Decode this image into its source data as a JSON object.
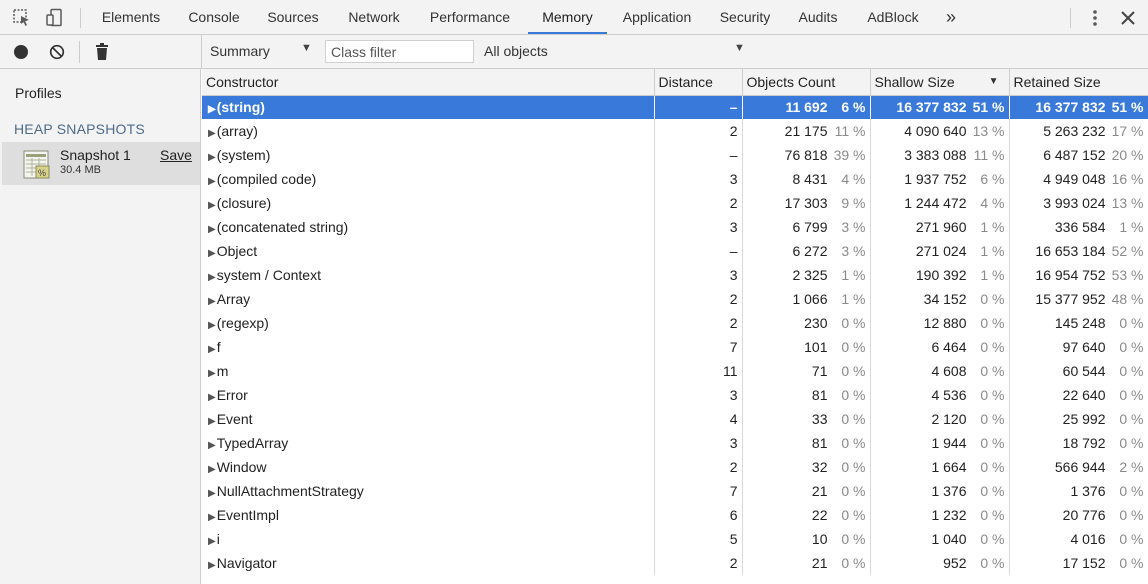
{
  "tabs": [
    {
      "label": "Elements",
      "active": false
    },
    {
      "label": "Console",
      "active": false
    },
    {
      "label": "Sources",
      "active": false
    },
    {
      "label": "Network",
      "active": false
    },
    {
      "label": "Performance",
      "active": false
    },
    {
      "label": "Memory",
      "active": true
    },
    {
      "label": "Application",
      "active": false
    },
    {
      "label": "Security",
      "active": false
    },
    {
      "label": "Audits",
      "active": false
    },
    {
      "label": "AdBlock",
      "active": false
    }
  ],
  "toolbar": {
    "overflow": "»",
    "view_select": "Summary",
    "class_filter_placeholder": "Class filter",
    "objects_select": "All objects"
  },
  "sidebar": {
    "title": "Profiles",
    "heading": "HEAP SNAPSHOTS",
    "snapshot": {
      "name": "Snapshot 1",
      "size": "30.4 MB",
      "save": "Save"
    }
  },
  "table": {
    "columns": [
      "Constructor",
      "Distance",
      "Objects Count",
      "Shallow Size",
      "Retained Size"
    ],
    "sorted_column": "Shallow Size",
    "rows": [
      {
        "name": "(string)",
        "distance": "–",
        "count": "11 692",
        "count_pct": "6 %",
        "shallow": "16 377 832",
        "shallow_pct": "51 %",
        "retained": "16 377 832",
        "retained_pct": "51 %",
        "selected": true
      },
      {
        "name": "(array)",
        "distance": "2",
        "count": "21 175",
        "count_pct": "11 %",
        "shallow": "4 090 640",
        "shallow_pct": "13 %",
        "retained": "5 263 232",
        "retained_pct": "17 %"
      },
      {
        "name": "(system)",
        "distance": "–",
        "count": "76 818",
        "count_pct": "39 %",
        "shallow": "3 383 088",
        "shallow_pct": "11 %",
        "retained": "6 487 152",
        "retained_pct": "20 %"
      },
      {
        "name": "(compiled code)",
        "distance": "3",
        "count": "8 431",
        "count_pct": "4 %",
        "shallow": "1 937 752",
        "shallow_pct": "6 %",
        "retained": "4 949 048",
        "retained_pct": "16 %"
      },
      {
        "name": "(closure)",
        "distance": "2",
        "count": "17 303",
        "count_pct": "9 %",
        "shallow": "1 244 472",
        "shallow_pct": "4 %",
        "retained": "3 993 024",
        "retained_pct": "13 %"
      },
      {
        "name": "(concatenated string)",
        "distance": "3",
        "count": "6 799",
        "count_pct": "3 %",
        "shallow": "271 960",
        "shallow_pct": "1 %",
        "retained": "336 584",
        "retained_pct": "1 %"
      },
      {
        "name": "Object",
        "distance": "–",
        "count": "6 272",
        "count_pct": "3 %",
        "shallow": "271 024",
        "shallow_pct": "1 %",
        "retained": "16 653 184",
        "retained_pct": "52 %"
      },
      {
        "name": "system / Context",
        "distance": "3",
        "count": "2 325",
        "count_pct": "1 %",
        "shallow": "190 392",
        "shallow_pct": "1 %",
        "retained": "16 954 752",
        "retained_pct": "53 %"
      },
      {
        "name": "Array",
        "distance": "2",
        "count": "1 066",
        "count_pct": "1 %",
        "shallow": "34 152",
        "shallow_pct": "0 %",
        "retained": "15 377 952",
        "retained_pct": "48 %"
      },
      {
        "name": "(regexp)",
        "distance": "2",
        "count": "230",
        "count_pct": "0 %",
        "shallow": "12 880",
        "shallow_pct": "0 %",
        "retained": "145 248",
        "retained_pct": "0 %"
      },
      {
        "name": "f",
        "distance": "7",
        "count": "101",
        "count_pct": "0 %",
        "shallow": "6 464",
        "shallow_pct": "0 %",
        "retained": "97 640",
        "retained_pct": "0 %"
      },
      {
        "name": "m",
        "distance": "11",
        "count": "71",
        "count_pct": "0 %",
        "shallow": "4 608",
        "shallow_pct": "0 %",
        "retained": "60 544",
        "retained_pct": "0 %"
      },
      {
        "name": "Error",
        "distance": "3",
        "count": "81",
        "count_pct": "0 %",
        "shallow": "4 536",
        "shallow_pct": "0 %",
        "retained": "22 640",
        "retained_pct": "0 %"
      },
      {
        "name": "Event",
        "distance": "4",
        "count": "33",
        "count_pct": "0 %",
        "shallow": "2 120",
        "shallow_pct": "0 %",
        "retained": "25 992",
        "retained_pct": "0 %"
      },
      {
        "name": "TypedArray",
        "distance": "3",
        "count": "81",
        "count_pct": "0 %",
        "shallow": "1 944",
        "shallow_pct": "0 %",
        "retained": "18 792",
        "retained_pct": "0 %"
      },
      {
        "name": "Window",
        "distance": "2",
        "count": "32",
        "count_pct": "0 %",
        "shallow": "1 664",
        "shallow_pct": "0 %",
        "retained": "566 944",
        "retained_pct": "2 %"
      },
      {
        "name": "NullAttachmentStrategy",
        "distance": "7",
        "count": "21",
        "count_pct": "0 %",
        "shallow": "1 376",
        "shallow_pct": "0 %",
        "retained": "1 376",
        "retained_pct": "0 %"
      },
      {
        "name": "EventImpl",
        "distance": "6",
        "count": "22",
        "count_pct": "0 %",
        "shallow": "1 232",
        "shallow_pct": "0 %",
        "retained": "20 776",
        "retained_pct": "0 %"
      },
      {
        "name": "i",
        "distance": "5",
        "count": "10",
        "count_pct": "0 %",
        "shallow": "1 040",
        "shallow_pct": "0 %",
        "retained": "4 016",
        "retained_pct": "0 %"
      },
      {
        "name": "Navigator",
        "distance": "2",
        "count": "21",
        "count_pct": "0 %",
        "shallow": "952",
        "shallow_pct": "0 %",
        "retained": "17 152",
        "retained_pct": "0 %"
      }
    ]
  },
  "colors": {
    "accent": "#3879d9",
    "toolbar_bg": "#f3f3f3",
    "selected_row_bg": "#3879d9"
  }
}
